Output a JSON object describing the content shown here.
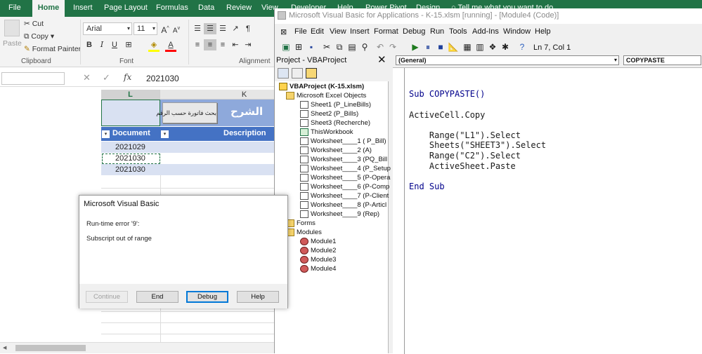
{
  "excel": {
    "tabs": [
      "File",
      "Home",
      "Insert",
      "Page Layout",
      "Formulas",
      "Data",
      "Review",
      "View",
      "Developer",
      "Help",
      "Power Pivot",
      "Design"
    ],
    "active_tab": "Home",
    "tell_me": "Tell me what you want to do",
    "clipboard": {
      "paste": "Paste",
      "cut": "Cut",
      "copy": "Copy",
      "format_painter": "Format Painter",
      "label": "Clipboard"
    },
    "font": {
      "name": "Arial",
      "size": "11",
      "grow": "A",
      "shrink": "A",
      "bold": "B",
      "italic": "I",
      "underline": "U",
      "label": "Font"
    },
    "alignment_label": "Alignment",
    "formula_bar": {
      "fx": "fx",
      "value": "2021030",
      "cancel": "✕",
      "enter": "✓"
    },
    "columns": [
      "L",
      "K"
    ],
    "button_text": "بحث فاتورة حسب الرقم",
    "header_arabic": "الشرح",
    "table_headers": [
      "Document",
      "Description"
    ],
    "rows": [
      "2021029",
      "2021030",
      "2021030"
    ],
    "colors": {
      "green": "#217346",
      "table_blue": "#4472c4",
      "band": "#d9e1f2"
    }
  },
  "vbe": {
    "title": "Microsoft Visual Basic for Applications - K-15.xlsm [running] - [Module4 (Code)]",
    "menu": [
      "File",
      "Edit",
      "View",
      "Insert",
      "Format",
      "Debug",
      "Run",
      "Tools",
      "Add-Ins",
      "Window",
      "Help"
    ],
    "position": "Ln 7, Col 1",
    "project_title": "Project - VBAProject",
    "tree": [
      {
        "label": "VBAProject (K-15.xlsm)",
        "indent": 0,
        "icon": "vba-project-icon"
      },
      {
        "label": "Microsoft Excel Objects",
        "indent": 1,
        "icon": "folder-icon"
      },
      {
        "label": "Sheet1 (P_LineBills)",
        "indent": 2,
        "icon": "sheet-icon"
      },
      {
        "label": "Sheet2 (P_Bills)",
        "indent": 2,
        "icon": "sheet-icon"
      },
      {
        "label": "Sheet3 (Recherche)",
        "indent": 2,
        "icon": "sheet-icon"
      },
      {
        "label": "ThisWorkbook",
        "indent": 2,
        "icon": "workbook-icon"
      },
      {
        "label": "Worksheet____1 ( P_Bill)",
        "indent": 2,
        "icon": "sheet-icon"
      },
      {
        "label": "Worksheet____2 (A)",
        "indent": 2,
        "icon": "sheet-icon"
      },
      {
        "label": "Worksheet____3 (PQ_Bill",
        "indent": 2,
        "icon": "sheet-icon"
      },
      {
        "label": "Worksheet____4 (P_Setup",
        "indent": 2,
        "icon": "sheet-icon"
      },
      {
        "label": "Worksheet____5 (P-Opera",
        "indent": 2,
        "icon": "sheet-icon"
      },
      {
        "label": "Worksheet____6 (P-Comp",
        "indent": 2,
        "icon": "sheet-icon"
      },
      {
        "label": "Worksheet____7 (P-Client",
        "indent": 2,
        "icon": "sheet-icon"
      },
      {
        "label": "Worksheet____8 (P-Articl",
        "indent": 2,
        "icon": "sheet-icon"
      },
      {
        "label": "Worksheet____9 (Rep)",
        "indent": 2,
        "icon": "sheet-icon"
      },
      {
        "label": "Forms",
        "indent": 1,
        "icon": "folder-icon"
      },
      {
        "label": "Modules",
        "indent": 1,
        "icon": "folder-icon"
      },
      {
        "label": "Module1",
        "indent": 2,
        "icon": "module-icon"
      },
      {
        "label": "Module2",
        "indent": 2,
        "icon": "module-icon"
      },
      {
        "label": "Module3",
        "indent": 2,
        "icon": "module-icon"
      },
      {
        "label": "Module4",
        "indent": 2,
        "icon": "module-icon"
      }
    ],
    "object_combo": "(General)",
    "proc_combo": "COPYPASTE",
    "code_lines": [
      "Sub COPYPASTE()",
      "ActiveCell.Copy",
      "    Range(\"L1\").Select",
      "    Sheets(\"SHEET3\").Select",
      "    Range(\"C2\").Select",
      "    ActiveSheet.Paste",
      "End Sub"
    ]
  },
  "dialog": {
    "title": "Microsoft Visual Basic",
    "message1": "Run-time error '9':",
    "message2": "Subscript out of range",
    "buttons": [
      "Continue",
      "End",
      "Debug",
      "Help"
    ]
  }
}
